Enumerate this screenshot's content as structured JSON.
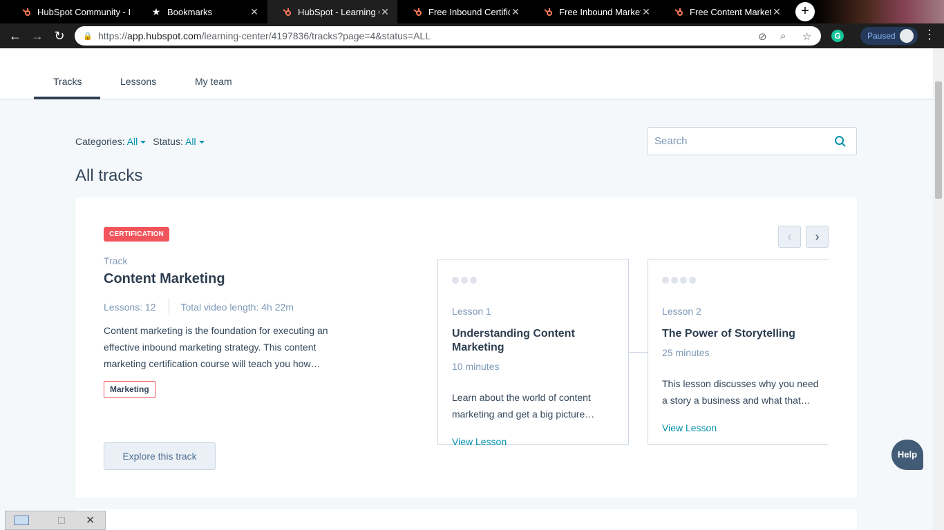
{
  "browser": {
    "tabs": [
      {
        "title": "HubSpot Community - I",
        "icon": "hubspot-icon",
        "active": false
      },
      {
        "title": "Bookmarks",
        "icon": "star-icon",
        "active": false
      },
      {
        "title": "HubSpot - Learning Cer",
        "icon": "hubspot-icon",
        "active": true
      },
      {
        "title": "Free Inbound Certificati",
        "icon": "hubspot-icon",
        "active": false
      },
      {
        "title": "Free Inbound Marketinc",
        "icon": "hubspot-icon",
        "active": false
      },
      {
        "title": "Free Content Marketing",
        "icon": "hubspot-icon",
        "active": false
      }
    ],
    "url_prefix": "https://",
    "url_host": "app.hubspot.com",
    "url_path": "/learning-center/4197836/tracks?page=4&status=ALL",
    "paused_label": "Paused"
  },
  "page_tabs": [
    {
      "label": "Tracks"
    },
    {
      "label": "Lessons"
    },
    {
      "label": "My team"
    }
  ],
  "filters": {
    "categories_label": "Categories:",
    "categories_value": "All",
    "status_label": "Status:",
    "status_value": "All"
  },
  "search": {
    "placeholder": "Search"
  },
  "heading": "All tracks",
  "track": {
    "badge": "CERTIFICATION",
    "label": "Track",
    "title": "Content Marketing",
    "lessons_count": "Lessons: 12",
    "video_length": "Total video length: 4h 22m",
    "description": "Content marketing is the foundation for executing an effective inbound marketing strategy. This content marketing certification course will teach you how…",
    "tag": "Marketing",
    "explore_label": "Explore this track"
  },
  "lessons": [
    {
      "number": "Lesson 1",
      "title": "Understanding Content Marketing",
      "duration": "10 minutes",
      "description": "Learn about the world of content marketing and get a big picture…",
      "link": "View Lesson"
    },
    {
      "number": "Lesson 2",
      "title": "The Power of Storytelling",
      "duration": "25 minutes",
      "description": "This lesson discusses why you need a story a business and what that…",
      "link": "View Lesson"
    }
  ],
  "help_label": "Help",
  "colors": {
    "accent_link": "#0091ae",
    "badge_red": "#f2545b",
    "heading_dark": "#2d3e50",
    "help_bubble": "#425b76"
  }
}
